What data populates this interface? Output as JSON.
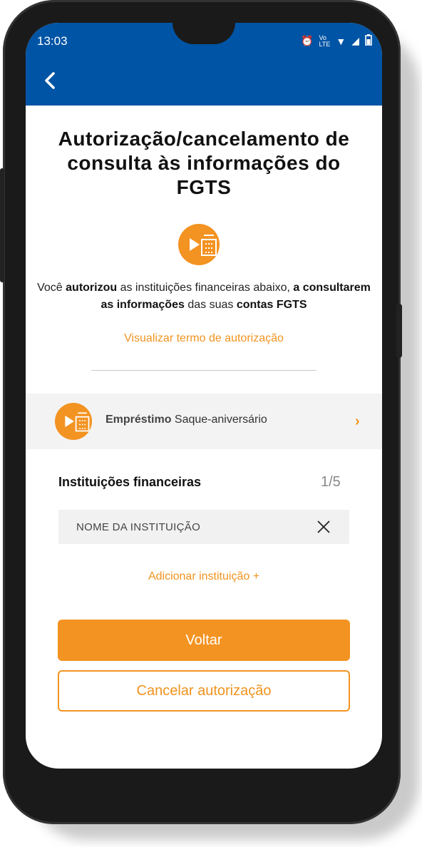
{
  "status_bar": {
    "time": "13:03",
    "icons": [
      "alarm-icon",
      "volte-icon",
      "wifi-icon",
      "signal-icon",
      "battery-icon"
    ]
  },
  "header": {
    "back_icon": "chevron-left-icon"
  },
  "page": {
    "title": "Autorização/cancelamento de consulta às informações do FGTS",
    "description": {
      "p1": "Você ",
      "b1": "autorizou",
      "p2": " as instituições financeiras abaixo, ",
      "b2": "a consultarem as informações",
      "p3": " das suas ",
      "b3": "contas FGTS"
    },
    "terms_link": "Visualizar termo de autorização"
  },
  "loan": {
    "bold": "Empréstimo",
    "label": " Saque-aniversário",
    "chevron": "›"
  },
  "institutions": {
    "title": "Instituições financeiras",
    "count": "1/5",
    "items": [
      {
        "name": "NOME DA INSTITUIÇÃO"
      }
    ],
    "add_link": "Adicionar instituição +"
  },
  "actions": {
    "back_label": "Voltar",
    "cancel_label": "Cancelar autorização"
  },
  "colors": {
    "primary_blue": "#0054a5",
    "accent_orange": "#f39322"
  }
}
